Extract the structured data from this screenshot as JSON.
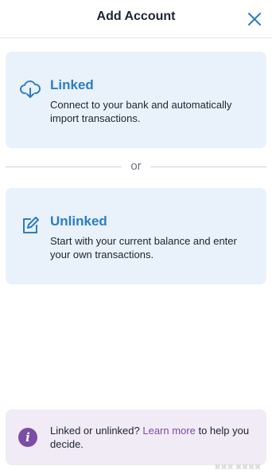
{
  "header": {
    "title": "Add Account",
    "close_icon": "close-icon"
  },
  "options": {
    "linked": {
      "icon": "cloud-download-icon",
      "title": "Linked",
      "description": "Connect to your bank and automatically import transactions."
    },
    "unlinked": {
      "icon": "edit-icon",
      "title": "Unlinked",
      "description": "Start with your current balance and enter your own transactions."
    }
  },
  "divider": {
    "text": "or"
  },
  "info": {
    "icon": "info-icon",
    "text_before": "Linked or unlinked? ",
    "link_text": "Learn more",
    "text_after": " to help you decide."
  },
  "watermark": "⌘⌘⌘.⌘⌘⌘⌘",
  "colors": {
    "accent_blue": "#2b7ec3",
    "card_bg": "#e9f1fb",
    "info_bg": "#f0ebf5",
    "purple": "#7b4ea6"
  }
}
